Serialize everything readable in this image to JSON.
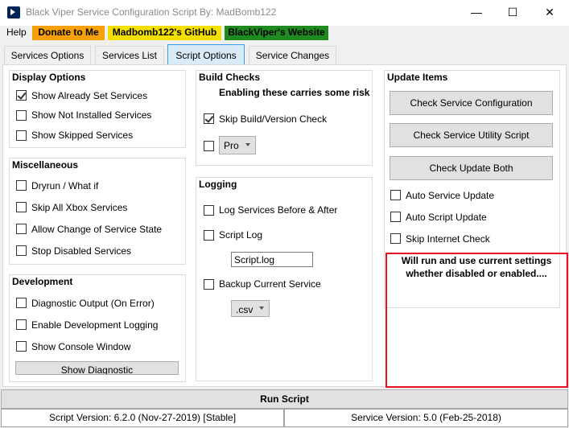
{
  "window": {
    "title": "Black Viper Service Configuration Script By: MadBomb122",
    "icon": "powershell-icon",
    "controls": {
      "minimize": "—",
      "maximize": "☐",
      "close": "✕"
    }
  },
  "menu": {
    "help": "Help",
    "donate": "Donate to Me",
    "github": "Madbomb122's GitHub",
    "website": "BlackViper's Website"
  },
  "tabs": [
    "Services Options",
    "Services List",
    "Script Options",
    "Service Changes"
  ],
  "active_tab": "Script Options",
  "display_options": {
    "title": "Display Options",
    "items": [
      {
        "label": "Show Already Set Services",
        "checked": true
      },
      {
        "label": "Show Not Installed Services",
        "checked": false
      },
      {
        "label": "Show Skipped Services",
        "checked": false
      }
    ]
  },
  "miscellaneous": {
    "title": "Miscellaneous",
    "items": [
      {
        "label": "Dryrun / What if",
        "checked": false
      },
      {
        "label": "Skip All Xbox Services",
        "checked": false
      },
      {
        "label": "Allow Change of Service State",
        "checked": false
      },
      {
        "label": "Stop Disabled Services",
        "checked": false
      }
    ]
  },
  "development": {
    "title": "Development",
    "items": [
      {
        "label": "Diagnostic Output (On Error)",
        "checked": false
      },
      {
        "label": "Enable Development Logging",
        "checked": false
      },
      {
        "label": "Show Console Window",
        "checked": false
      }
    ],
    "button": "Show Diagnostic"
  },
  "build_checks": {
    "title": "Build Checks",
    "warning": "Enabling these carries some risk",
    "skip_build": {
      "label": "Skip Build/Version Check",
      "checked": true
    },
    "edition_checked": false,
    "edition_value": "Pro"
  },
  "logging": {
    "title": "Logging",
    "log_services": {
      "label": "Log Services Before & After",
      "checked": false
    },
    "script_log": {
      "label": "Script Log",
      "checked": false
    },
    "script_log_file": "Script.log",
    "backup": {
      "label": "Backup Current Service",
      "checked": false
    },
    "backup_format": ".csv"
  },
  "update_items": {
    "title": "Update Items",
    "buttons": [
      "Check Service Configuration",
      "Check Service Utility Script",
      "Check Update Both"
    ],
    "options": [
      {
        "label": "Auto Service Update",
        "checked": false
      },
      {
        "label": "Auto Script Update",
        "checked": false
      },
      {
        "label": "Skip Internet Check",
        "checked": false
      }
    ],
    "note_line1": "Will run and use current settings",
    "note_line2": "whether disabled or enabled...."
  },
  "run_button": "Run Script",
  "status": {
    "script_version": "Script Version: 6.2.0 (Nov-27-2019) [Stable]",
    "service_version": "Service Version: 5.0 (Feb-25-2018)"
  },
  "colors": {
    "donate": "#f7a10a",
    "github": "#f4e000",
    "website": "#1f8a1f",
    "active_tab": "#d9ebf9",
    "highlight": "#e81123"
  }
}
